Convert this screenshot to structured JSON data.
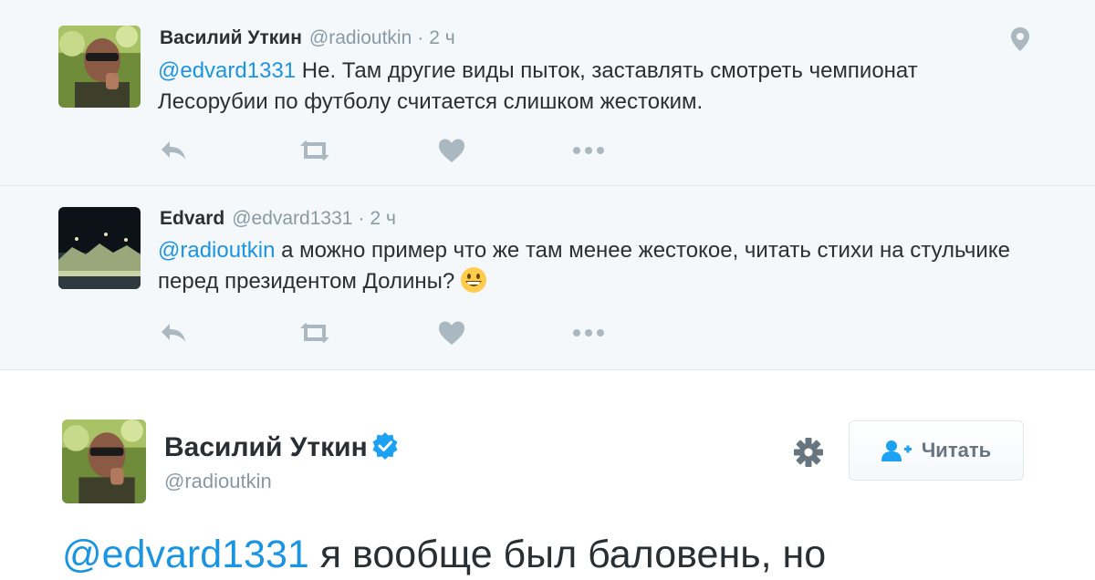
{
  "thread": [
    {
      "name": "Василий Уткин",
      "handle": "@radioutkin",
      "separator": "·",
      "time": "2 ч",
      "mention": "@edvard1331",
      "text": " Не. Там другие виды пыток, заставлять смотреть чемпионат Лесорубии по футболу считается слишком жестоким.",
      "has_geo_icon": true
    },
    {
      "name": "Edvard",
      "handle": "@edvard1331",
      "separator": "·",
      "time": "2 ч",
      "mention": "@radioutkin",
      "text": " а можно пример что же там менее жестокое, читать стихи на стульчике перед президентом Долины?",
      "emoji": "grinning-face-emoji"
    }
  ],
  "actions": [
    "reply-icon",
    "retweet-icon",
    "like-icon",
    "more-icon"
  ],
  "main_tweet": {
    "name": "Василий Уткин",
    "verified": true,
    "handle": "@radioutkin",
    "follow_label": "Читать",
    "mention": "@edvard1331",
    "text": " я вообще был баловень, но"
  },
  "colors": {
    "link": "#1b95e0",
    "muted": "#8899a6",
    "thread_bg": "#f5f8fa",
    "action_icon": "#aab8c2",
    "verified": "#1da1f2"
  }
}
